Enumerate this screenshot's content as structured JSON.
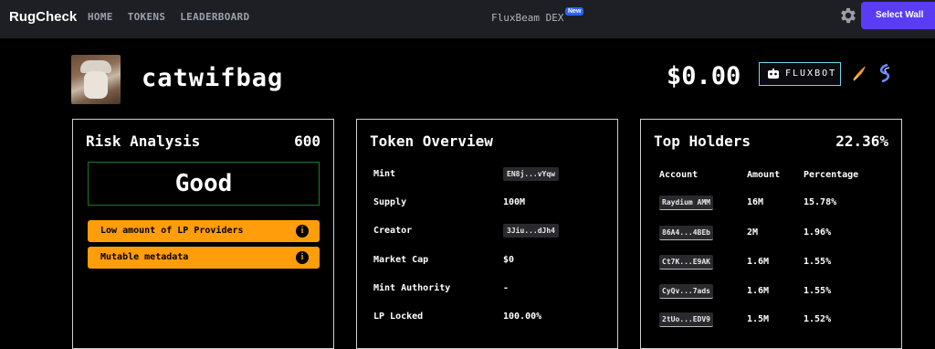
{
  "header": {
    "logo": "RugCheck",
    "nav": [
      "HOME",
      "TOKENS",
      "LEADERBOARD"
    ],
    "center_title": "FluxBeam DEX",
    "new_badge": "New",
    "wallet_button": "Select Wall"
  },
  "token": {
    "name": "catwifbag",
    "price": "$0.00",
    "fluxbot_label": "FLUXBOT"
  },
  "risk": {
    "title": "Risk Analysis",
    "score": "600",
    "rating": "Good",
    "items": [
      "Low amount of LP Providers",
      "Mutable metadata"
    ]
  },
  "overview": {
    "title": "Token Overview",
    "rows": [
      {
        "label": "Mint",
        "value": "EN8j...vYqw"
      },
      {
        "label": "Supply",
        "value": "100M"
      },
      {
        "label": "Creator",
        "value": "3Jiu...dJh4"
      },
      {
        "label": "Market Cap",
        "value": "$0"
      },
      {
        "label": "Mint Authority",
        "value": "-"
      },
      {
        "label": "LP Locked",
        "value": "100.00%"
      }
    ]
  },
  "holders": {
    "title": "Top Holders",
    "total": "22.36%",
    "columns": [
      "Account",
      "Amount",
      "Percentage"
    ],
    "rows": [
      {
        "account": "Raydium AMM",
        "amount": "16M",
        "percentage": "15.78%"
      },
      {
        "account": "86A4...4BEb",
        "amount": "2M",
        "percentage": "1.96%"
      },
      {
        "account": "Ct7K...E9AK",
        "amount": "1.6M",
        "percentage": "1.55%"
      },
      {
        "account": "CyQv...7ads",
        "amount": "1.6M",
        "percentage": "1.55%"
      },
      {
        "account": "2tUo...EDV9",
        "amount": "1.5M",
        "percentage": "1.52%"
      }
    ]
  },
  "colors": {
    "risk_item": "#ff9d0a",
    "good_border": "#1d7a2a",
    "wallet": "#5b3cf5",
    "new_badge": "#2b63ff"
  },
  "icons": {
    "settings": "gear-icon",
    "fluxbot": "robot-icon",
    "bird": "bird-icon",
    "swirl": "swirl-icon",
    "info": "info-icon"
  }
}
